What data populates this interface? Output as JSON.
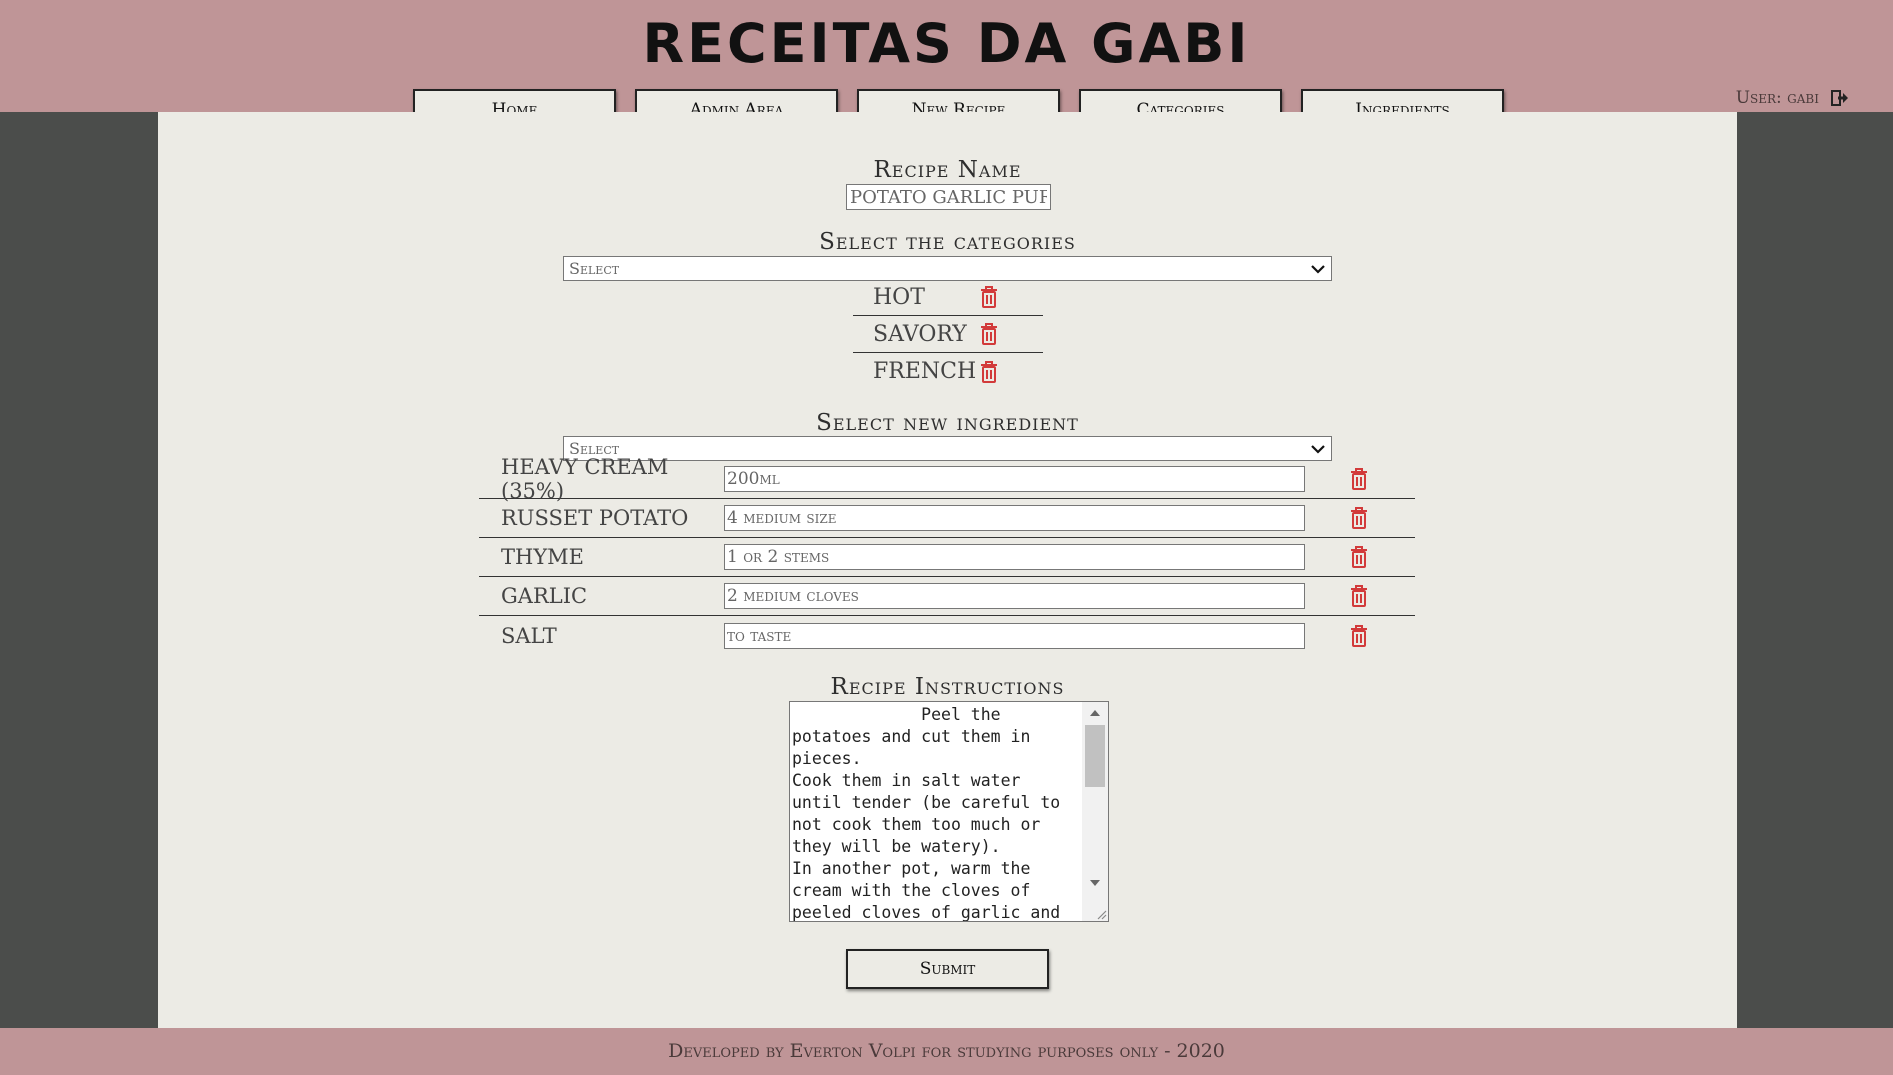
{
  "site_title": "RECEITAS DA GABI",
  "user_label": "User: gabi",
  "nav": [
    {
      "label": "Home"
    },
    {
      "label": "Admin Area"
    },
    {
      "label": "New Recipe"
    },
    {
      "label": "Categories"
    },
    {
      "label": "Ingredients"
    }
  ],
  "form": {
    "recipe_name_label": "Recipe Name",
    "recipe_name_value": "POTATO GARLIC PURE",
    "categories_label": "Select the categories",
    "categories_select": "Select",
    "categories": [
      {
        "name": "hot"
      },
      {
        "name": "savory"
      },
      {
        "name": "french"
      }
    ],
    "ingredient_label": "Select new ingredient",
    "ingredient_select": "Select",
    "ingredients": [
      {
        "name": "heavy cream (35%)",
        "qty": "200ml"
      },
      {
        "name": "russet potato",
        "qty": "4 medium size"
      },
      {
        "name": "thyme",
        "qty": "1 or 2 stems"
      },
      {
        "name": "garlic",
        "qty": "2 medium cloves"
      },
      {
        "name": "salt",
        "qty": "to taste"
      }
    ],
    "instructions_label": "Recipe Instructions",
    "instructions_text": "             Peel the potatoes and cut them in pieces.\nCook them in salt water until tender (be careful to not cook them too much or they will be watery).\nIn another pot, warm the cream with the cloves of peeled cloves of garlic and the stems of thyme. Add salt",
    "submit_label": "Submit"
  },
  "footer_text": "Developed by Everton Volpi for studying purposes only - 2020",
  "colors": {
    "header_bg": "#bf9597",
    "content_bg": "#ecebe5",
    "side_bg": "#4b4d4b",
    "trash_red": "#d23a3a"
  },
  "icons": {
    "trash": "trash-icon",
    "logout": "logout-icon",
    "dropdown": "chevron-down-icon"
  }
}
